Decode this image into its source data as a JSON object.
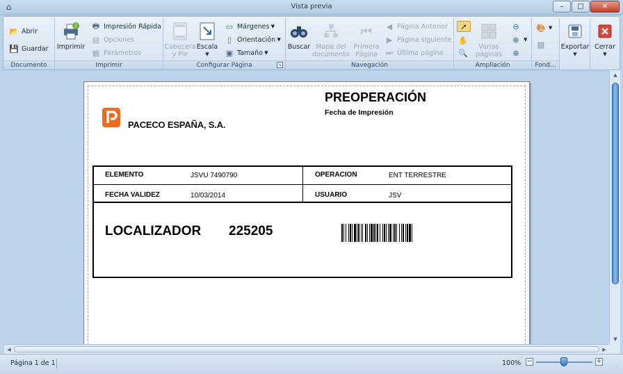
{
  "window": {
    "title": "Vista previa",
    "minimize": "–",
    "maximize": "□",
    "close": "✕"
  },
  "ribbon": {
    "documento": {
      "label": "Documento",
      "abrir": "Abrir",
      "guardar": "Guardar"
    },
    "imprimir": {
      "label": "Imprimir",
      "imprimir": "Imprimir",
      "impresion_rapida": "Impresión Rápida",
      "opciones": "Opciones",
      "parametros": "Parámetros"
    },
    "configurar": {
      "label": "Configurar Página",
      "cabecera_line1": "Cabecera",
      "cabecera_line2": "y Pie",
      "escala": "Escala",
      "margenes": "Márgenes",
      "orientacion": "Orientación",
      "tamano": "Tamaño"
    },
    "navegacion": {
      "label": "Navegación",
      "buscar": "Buscar",
      "mapa_line1": "Mapa del",
      "mapa_line2": "documento",
      "primera_line1": "Primera",
      "primera_line2": "Página",
      "pagina_anterior": "Página Anterior",
      "pagina_siguiente": "Página siguiente",
      "ultima_pagina": "Última página"
    },
    "ampliacion": {
      "label": "Ampliación",
      "varias_line1": "Varias",
      "varias_line2": "páginas"
    },
    "fondo": {
      "label": "Fond..."
    },
    "exportar": "Exportar",
    "cerrar": "Cerrar"
  },
  "document": {
    "company": "PACECO ESPAÑA, S.A.",
    "title": "PREOPERACIÓN",
    "subtitle": "Fecha de Impresión",
    "rows": [
      {
        "label1": "ELEMENTO",
        "value1": "JSVU 7490790",
        "label2": "OPERACION",
        "value2": "ENT TERRESTRE"
      },
      {
        "label1": "FECHA VALIDEZ",
        "value1": "10/03/2014",
        "label2": "USUARIO",
        "value2": "JSV"
      }
    ],
    "localizador_label": "LOCALIZADOR",
    "localizador_value": "225205"
  },
  "status": {
    "page": "Página 1 de 1",
    "zoom": "100%",
    "zoom_level_percent": 100
  },
  "colors": {
    "logo_orange": "#ee6a1c",
    "ribbon_bg": "#d6e3f2",
    "workspace_bg": "#bcd3ea"
  }
}
